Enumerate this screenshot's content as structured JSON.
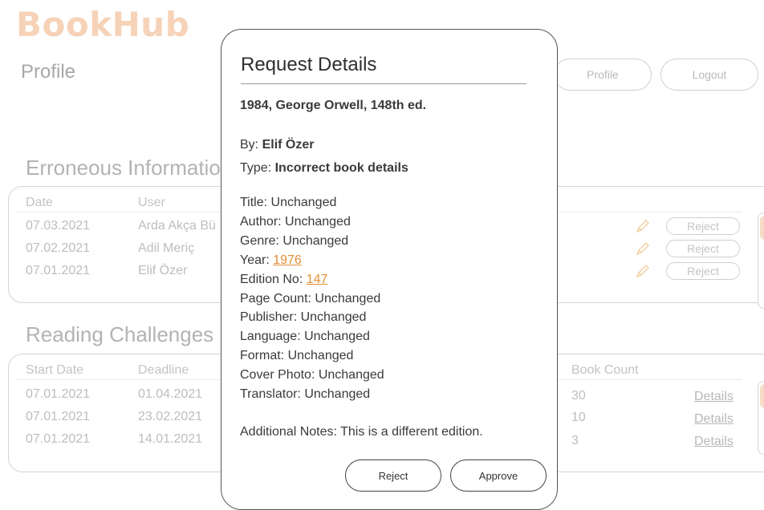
{
  "app": {
    "logo": "BookHub"
  },
  "page": {
    "title": "Profile"
  },
  "nav": {
    "profile_label": "Profile",
    "logout_label": "Logout"
  },
  "colors": {
    "accent": "#e38f35",
    "logo": "#f6d3b8"
  },
  "erroneous": {
    "title": "Erroneous Information",
    "headers": {
      "date": "Date",
      "user": "User"
    },
    "rows": [
      {
        "date": "07.03.2021",
        "user": "Arda Akça Bü",
        "reject_label": "Reject"
      },
      {
        "date": "07.02.2021",
        "user": "Adil Meriç",
        "reject_label": "Reject"
      },
      {
        "date": "07.01.2021",
        "user": "Elif Özer",
        "reject_label": "Reject"
      }
    ]
  },
  "challenges": {
    "title": "Reading Challenges",
    "headers": {
      "start": "Start Date",
      "deadline": "Deadline",
      "count": "Book Count"
    },
    "rows": [
      {
        "start": "07.01.2021",
        "deadline": "01.04.2021",
        "count": "30",
        "details_label": "Details"
      },
      {
        "start": "07.01.2021",
        "deadline": "23.02.2021",
        "count": "10",
        "details_label": "Details"
      },
      {
        "start": "07.01.2021",
        "deadline": "14.01.2021",
        "count": "3",
        "details_label": "Details"
      }
    ]
  },
  "modal": {
    "title": "Request Details",
    "book": "1984, George Orwell, 148th ed.",
    "by_label": "By:",
    "by_value": "Elif Özer",
    "type_label": "Type:",
    "type_value": "Incorrect book details",
    "fields": {
      "title": "Title: Unchanged",
      "author": "Author: Unchanged",
      "genre": "Genre: Unchanged",
      "year_label": "Year:",
      "year_value": "1976",
      "edition_label": "Edition No:",
      "edition_value": "147",
      "page_count": "Page Count: Unchanged",
      "publisher": "Publisher: Unchanged",
      "language": "Language: Unchanged",
      "format": "Format: Unchanged",
      "cover": "Cover Photo: Unchanged",
      "translator": "Translator: Unchanged"
    },
    "notes": "Additional Notes: This is a different edition.",
    "reject_label": "Reject",
    "approve_label": "Approve"
  }
}
